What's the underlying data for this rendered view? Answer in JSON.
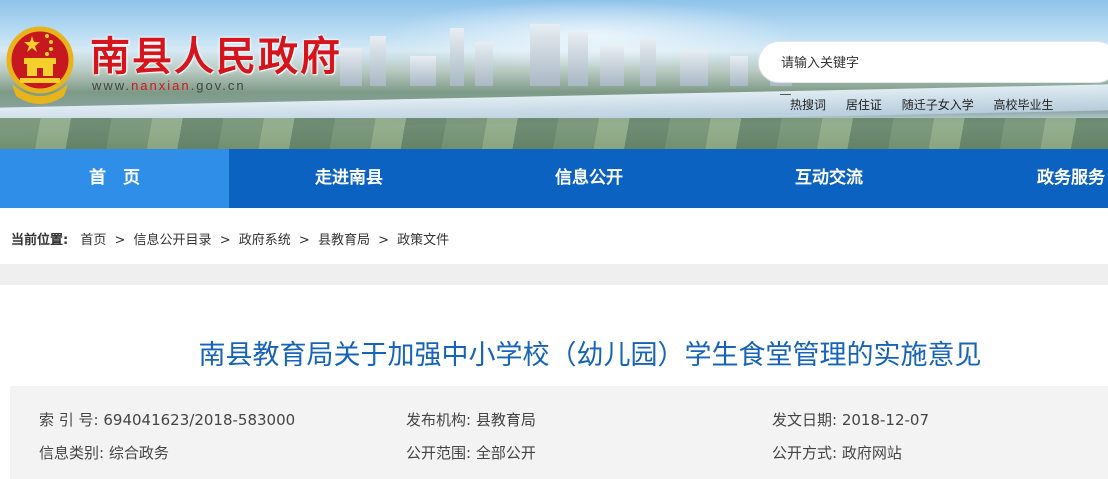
{
  "header": {
    "site_name": "南县人民政府",
    "url_prefix": "www.",
    "url_domain": "nanxian",
    "url_suffix": ".gov.cn"
  },
  "search": {
    "placeholder": "请输入关键字",
    "hot_label": "热搜词",
    "hot_terms": [
      "居住证",
      "随迁子女入学",
      "高校毕业生"
    ]
  },
  "nav": {
    "items": [
      "首　页",
      "走进南县",
      "信息公开",
      "互动交流",
      "政务服务"
    ],
    "active_color": "#2f8ee7",
    "bar_color": "#0b62c1"
  },
  "breadcrumb": {
    "label": "当前位置:",
    "items": [
      "首页",
      "信息公开目录",
      "政府系统",
      "县教育局",
      "政策文件"
    ],
    "separator": ">"
  },
  "article": {
    "title": "南县教育局关于加强中小学校（幼儿园）学生食堂管理的实施意见",
    "meta": {
      "index_label": "索 引 号:",
      "index_value": "694041623/2018-583000",
      "publisher_label": "发布机构:",
      "publisher_value": "县教育局",
      "date_label": "发文日期:",
      "date_value": "2018-12-07",
      "category_label": "信息类别:",
      "category_value": "综合政务",
      "scope_label": "公开范围:",
      "scope_value": "全部公开",
      "method_label": "公开方式:",
      "method_value": "政府网站"
    }
  },
  "colors": {
    "title_red": "#d6141d",
    "article_blue": "#1763b8"
  }
}
